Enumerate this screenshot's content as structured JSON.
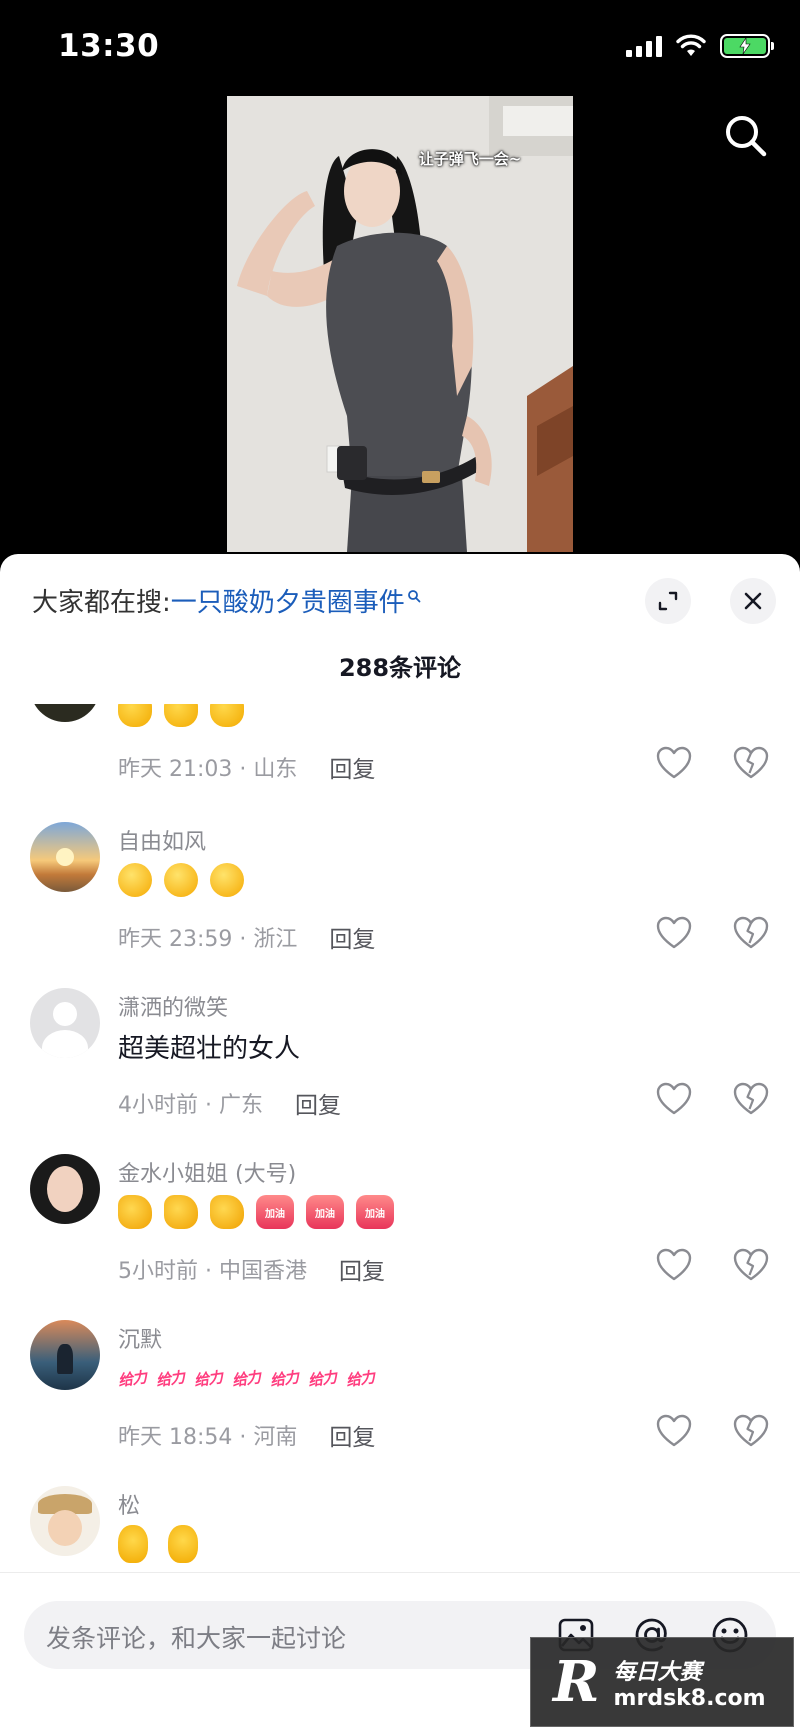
{
  "status_bar": {
    "time": "13:30"
  },
  "video": {
    "caption": "让子弹飞一会~"
  },
  "sheet": {
    "hot_search_prefix": "大家都在搜:",
    "hot_search_term": "一只酸奶夕贵圈事件",
    "comment_count": "288条评论"
  },
  "comments": [
    {
      "username": "",
      "emojis": [
        "clap",
        "clap",
        "clap"
      ],
      "meta": "昨天 21:03 · 山东",
      "reply": "回复"
    },
    {
      "username": "自由如风",
      "emojis": [
        "wink",
        "wink",
        "wink"
      ],
      "meta": "昨天 23:59 · 浙江",
      "reply": "回复"
    },
    {
      "username": "潇洒的微笑",
      "text": "超美超壮的女人",
      "meta": "4小时前 · 广东",
      "reply": "回复"
    },
    {
      "username": "金水小姐姐 (大号)",
      "emojis": [
        "thumb",
        "thumb",
        "thumb",
        "jiayou",
        "jiayou",
        "jiayou"
      ],
      "sticker_text": "加油",
      "meta": "5小时前 · 中国香港",
      "reply": "回复"
    },
    {
      "username": "沉默",
      "sticker_text": "给力",
      "meta": "昨天 18:54 · 河南",
      "reply": "回复"
    },
    {
      "username": "松",
      "emojis": [
        "heart",
        "heart"
      ]
    }
  ],
  "input": {
    "placeholder": "发条评论，和大家一起讨论"
  },
  "watermark": {
    "logo": "R",
    "line1": "每日大赛",
    "line2": "mrdsk8.com"
  },
  "colors": {
    "hot_search_term": "#1b5dba",
    "battery": "#4cd964",
    "geili": "#ff3d7f"
  }
}
